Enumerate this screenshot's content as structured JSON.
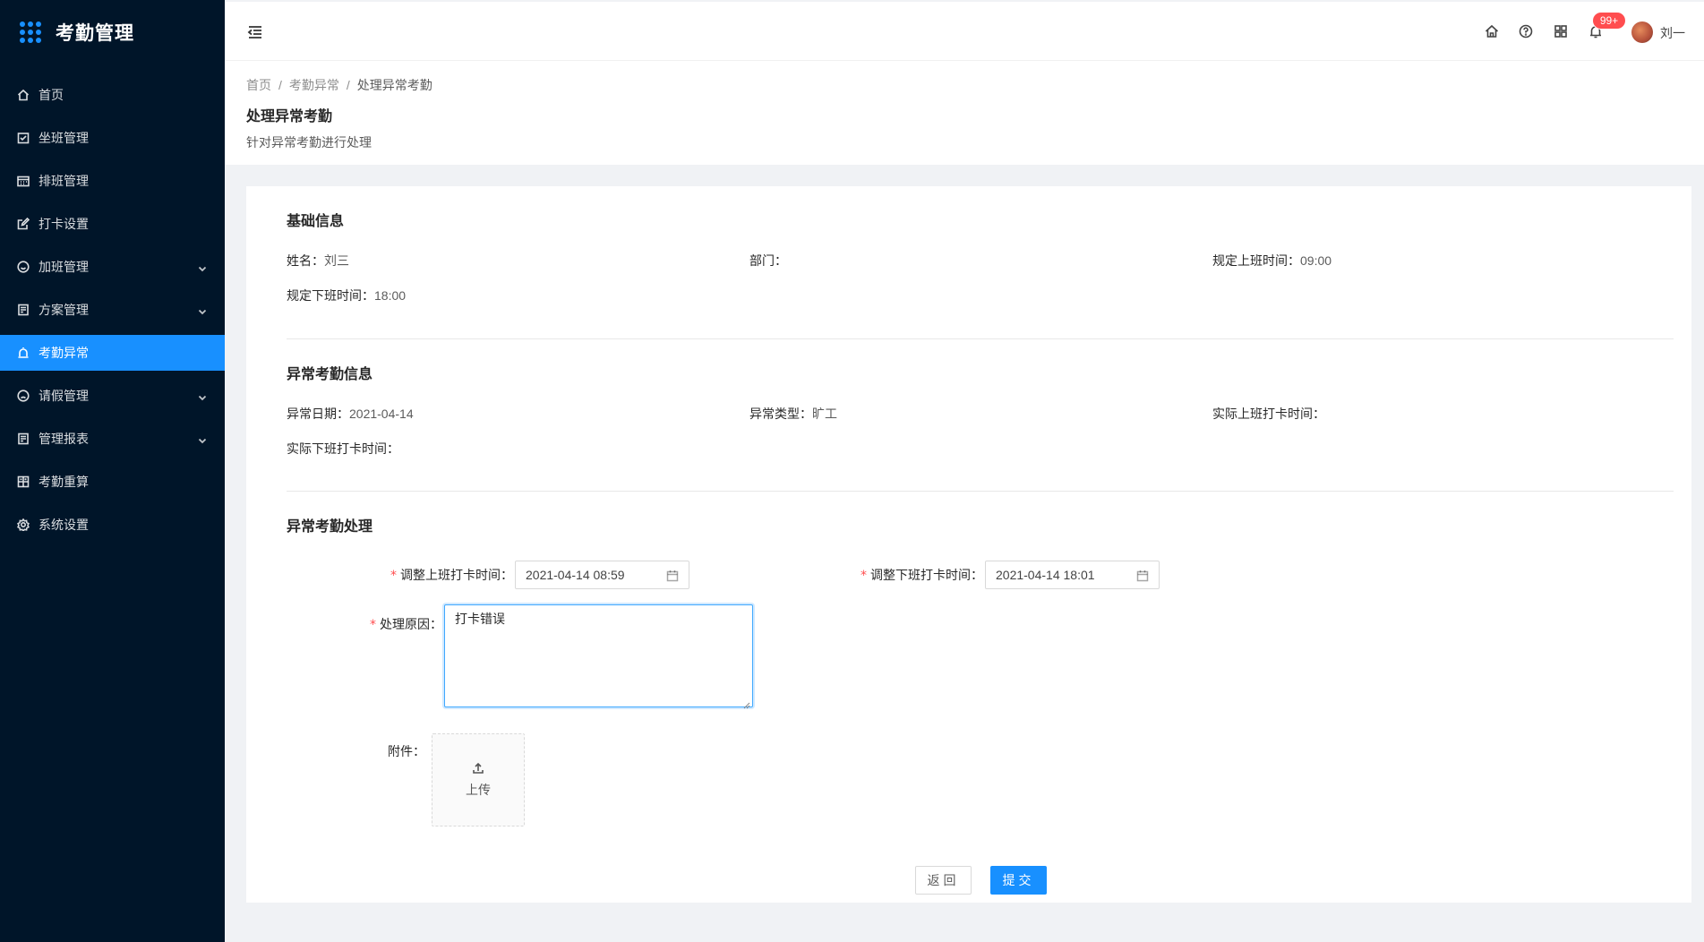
{
  "app": {
    "title": "考勤管理"
  },
  "sidebar": {
    "items": [
      {
        "label": "首页",
        "icon": "home-icon",
        "has_arrow": false,
        "active": false
      },
      {
        "label": "坐班管理",
        "icon": "calendar-check-icon",
        "has_arrow": false,
        "active": false
      },
      {
        "label": "排班管理",
        "icon": "schedule-icon",
        "has_arrow": false,
        "active": false
      },
      {
        "label": "打卡设置",
        "icon": "edit-icon",
        "has_arrow": false,
        "active": false
      },
      {
        "label": "加班管理",
        "icon": "smile-icon",
        "has_arrow": true,
        "active": false
      },
      {
        "label": "方案管理",
        "icon": "document-icon",
        "has_arrow": true,
        "active": false
      },
      {
        "label": "考勤异常",
        "icon": "alert-icon",
        "has_arrow": false,
        "active": true
      },
      {
        "label": "请假管理",
        "icon": "frown-icon",
        "has_arrow": true,
        "active": false
      },
      {
        "label": "管理报表",
        "icon": "report-icon",
        "has_arrow": true,
        "active": false
      },
      {
        "label": "考勤重算",
        "icon": "calculator-icon",
        "has_arrow": false,
        "active": false
      },
      {
        "label": "系统设置",
        "icon": "setting-icon",
        "has_arrow": false,
        "active": false
      }
    ]
  },
  "header": {
    "notification_badge": "99+",
    "user_name": "刘一"
  },
  "breadcrumb": [
    "首页",
    "考勤异常",
    "处理异常考勤"
  ],
  "page": {
    "title": "处理异常考勤",
    "description": "针对异常考勤进行处理"
  },
  "basic_info": {
    "title": "基础信息",
    "name_label": "姓名：",
    "name_value": "刘三",
    "dept_label": "部门：",
    "dept_value": "",
    "start_label": "规定上班时间：",
    "start_value": "09:00",
    "end_label": "规定下班时间：",
    "end_value": "18:00"
  },
  "abnormal_info": {
    "title": "异常考勤信息",
    "date_label": "异常日期：",
    "date_value": "2021-04-14",
    "type_label": "异常类型：",
    "type_value": "旷工",
    "actual_in_label": "实际上班打卡时间：",
    "actual_in_value": "",
    "actual_out_label": "实际下班打卡时间：",
    "actual_out_value": ""
  },
  "handling": {
    "title": "异常考勤处理",
    "adjust_in_label": "调整上班打卡时间：",
    "adjust_in_value": "2021-04-14 08:59",
    "adjust_out_label": "调整下班打卡时间：",
    "adjust_out_value": "2021-04-14 18:01",
    "reason_label": "处理原因：",
    "reason_value": "打卡错误",
    "attachment_label": "附件：",
    "upload_label": "上传"
  },
  "buttons": {
    "back": "返回",
    "submit": "提交"
  },
  "colors": {
    "sidebar_bg": "#001529",
    "primary": "#1890ff",
    "badge": "#ff4d4f",
    "required": "#ff4d4f"
  }
}
